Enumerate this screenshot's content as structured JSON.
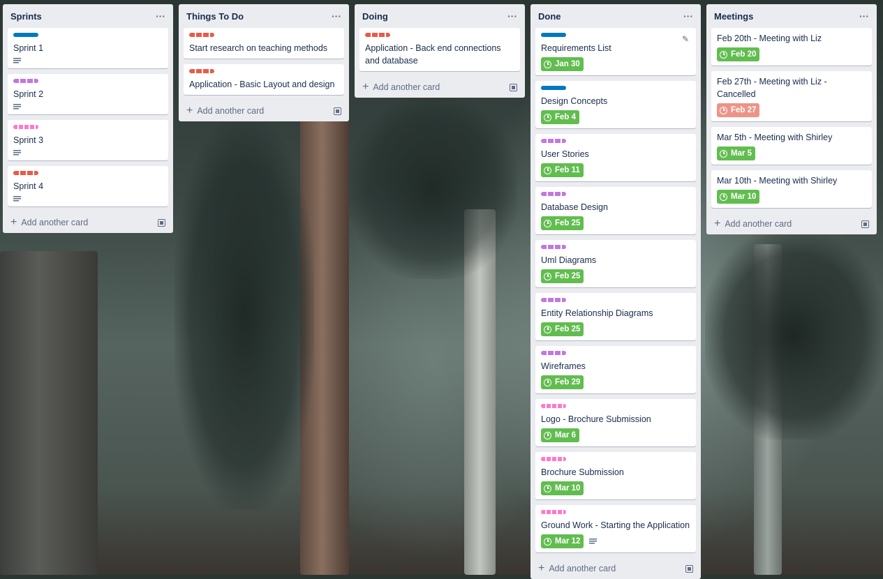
{
  "board": {
    "lists": [
      {
        "title": "Sprints",
        "add_label": "Add another card",
        "cards": [
          {
            "label": "blue",
            "title": "Sprint 1",
            "desc": true
          },
          {
            "label": "purple",
            "title": "Sprint 2",
            "desc": true
          },
          {
            "label": "pink",
            "title": "Sprint 3",
            "desc": true
          },
          {
            "label": "red",
            "title": "Sprint 4",
            "desc": true
          }
        ]
      },
      {
        "title": "Things To Do",
        "add_label": "Add another card",
        "cards": [
          {
            "label": "red",
            "title": "Start research on teaching methods"
          },
          {
            "label": "red",
            "title": "Application - Basic Layout and design"
          }
        ]
      },
      {
        "title": "Doing",
        "add_label": "Add another card",
        "cards": [
          {
            "label": "red",
            "title": "Application - Back end connections and database"
          }
        ]
      },
      {
        "title": "Done",
        "add_label": "Add another card",
        "cards": [
          {
            "label": "blue",
            "title": "Requirements List",
            "due": "Jan 30",
            "edit": true
          },
          {
            "label": "blue",
            "title": "Design Concepts",
            "due": "Feb 4"
          },
          {
            "label": "purple",
            "title": "User Stories",
            "due": "Feb 11"
          },
          {
            "label": "purple",
            "title": "Database Design",
            "due": "Feb 25"
          },
          {
            "label": "purple",
            "title": "Uml Diagrams",
            "due": "Feb 25"
          },
          {
            "label": "purple",
            "title": "Entity Relationship Diagrams",
            "due": "Feb 25"
          },
          {
            "label": "purple",
            "title": "Wireframes",
            "due": "Feb 29"
          },
          {
            "label": "pink",
            "title": "Logo - Brochure Submission",
            "due": "Mar 6"
          },
          {
            "label": "pink",
            "title": "Brochure Submission",
            "due": "Mar 10"
          },
          {
            "label": "pink",
            "title": "Ground Work - Starting the Application",
            "due": "Mar 12",
            "desc": true
          }
        ]
      },
      {
        "title": "Meetings",
        "add_label": "Add another card",
        "cards": [
          {
            "title": "Feb 20th - Meeting with Liz",
            "due": "Feb 20"
          },
          {
            "title": "Feb 27th - Meeting with Liz - Cancelled",
            "due": "Feb 27",
            "due_color": "red"
          },
          {
            "title": "Mar 5th - Meeting with Shirley",
            "due": "Mar 5"
          },
          {
            "title": "Mar 10th - Meeting with Shirley",
            "due": "Mar 10"
          }
        ]
      }
    ]
  },
  "colors": {
    "label_blue": "#0079bf",
    "label_purple": "#c377e0",
    "label_pink": "#ff78cb",
    "label_red": "#eb5a46",
    "due_complete": "#61bd4f",
    "due_overdue": "#ec9488",
    "list_bg": "#ebecf0"
  }
}
